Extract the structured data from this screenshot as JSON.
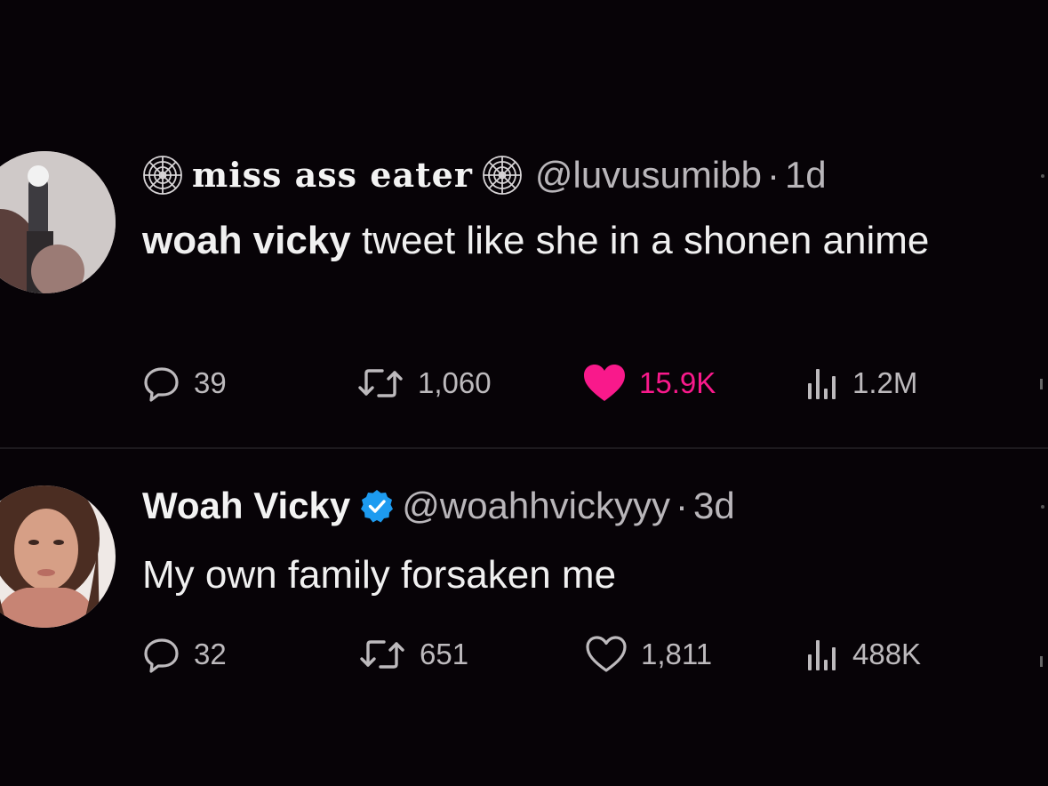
{
  "tweets": [
    {
      "display_name": "miss ass eater",
      "handle": "@luvusumibb",
      "separator": "·",
      "time": "1d",
      "text_bold": "woah vicky",
      "text_rest": " tweet like she in a shonen anime",
      "avatar_icon": "avatar-icon",
      "name_icons": [
        "spiderweb-icon",
        "spiderweb-icon"
      ],
      "replies": "39",
      "retweets": "1,060",
      "likes": "15.9K",
      "views": "1.2M",
      "liked": true,
      "like_color": "#f9198b"
    },
    {
      "display_name": "Woah Vicky",
      "handle": "@woahhvickyyy",
      "separator": "·",
      "time": "3d",
      "text": "My own family forsaken me",
      "avatar_icon": "avatar-icon",
      "verified_icon": "verified-badge-icon",
      "verified_color": "#1d9bf0",
      "replies": "32",
      "retweets": "651",
      "likes": "1,811",
      "views": "488K",
      "liked": false
    }
  ]
}
